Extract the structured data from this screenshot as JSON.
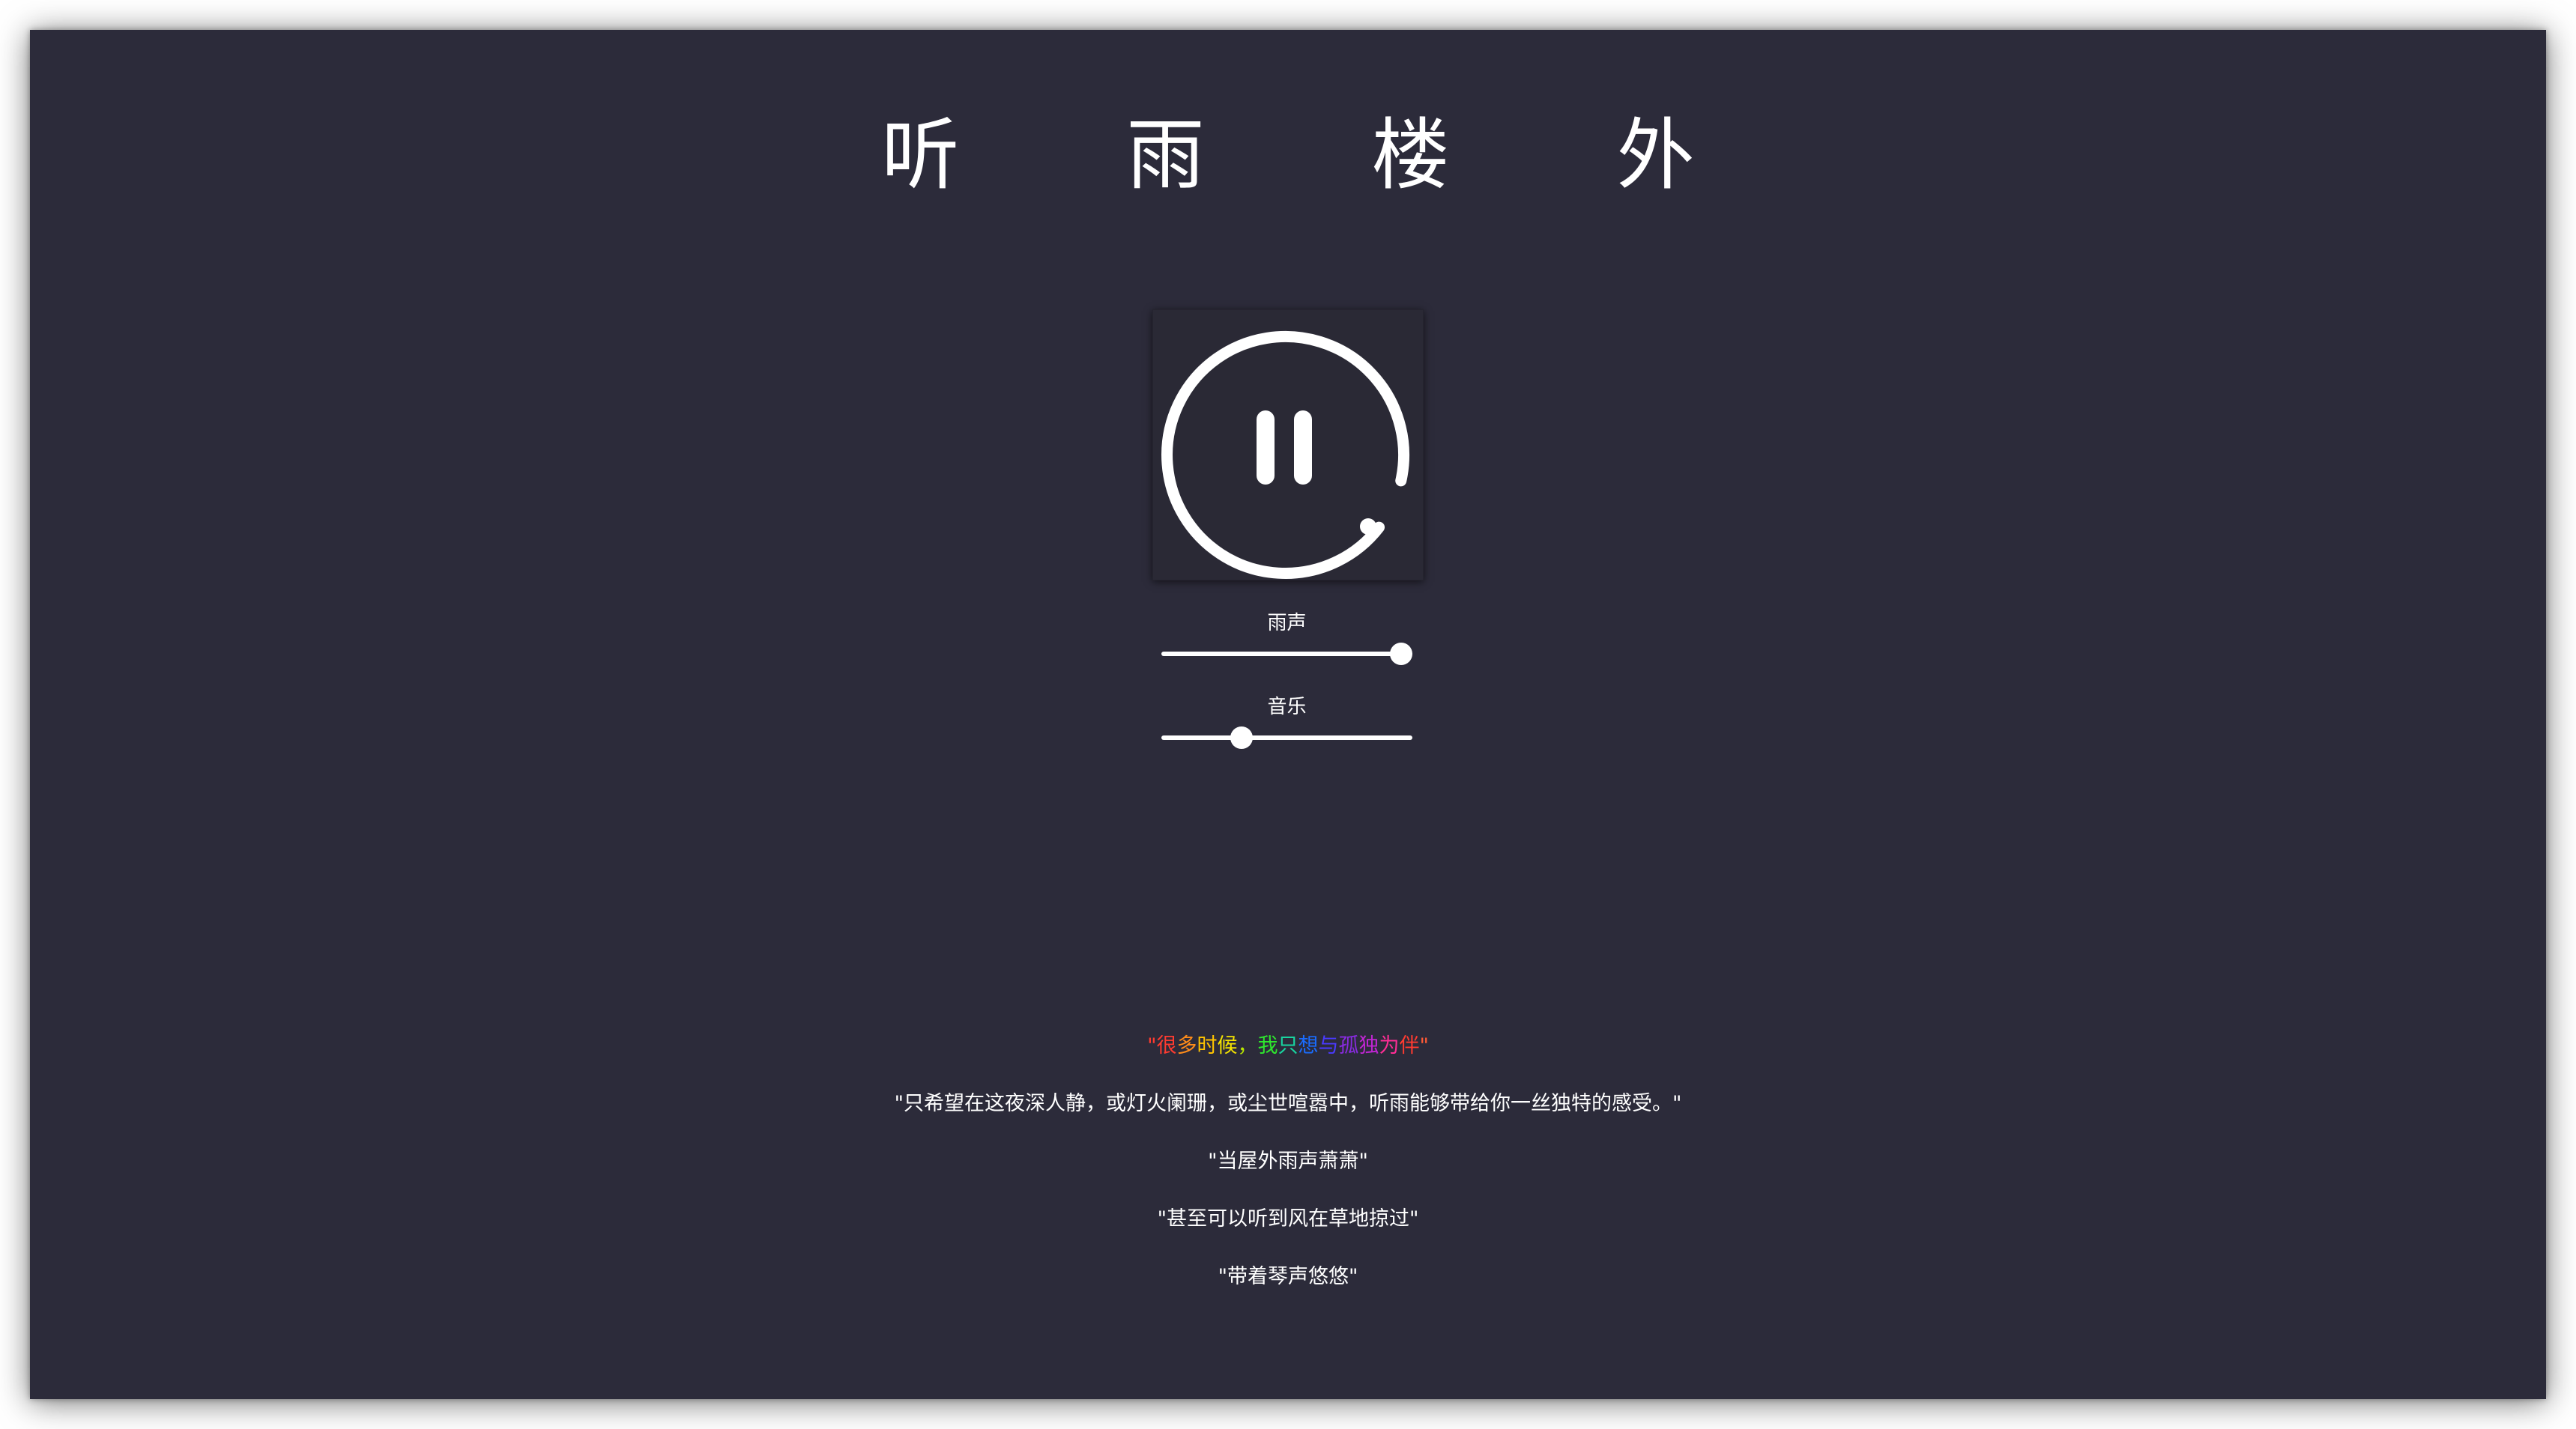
{
  "page": {
    "title": "听 雨 楼 外",
    "background": "#2c2b3a",
    "accent": "#ffffff"
  },
  "player": {
    "state": "playing",
    "icon": "pause-icon"
  },
  "sliders": [
    {
      "label": "雨声",
      "value_fraction": 0.955
    },
    {
      "label": "音乐",
      "value_fraction": 0.32
    }
  ],
  "quotes": {
    "first_chars": [
      {
        "ch": "\"",
        "color": "#ff3b30"
      },
      {
        "ch": "很",
        "color": "#ff3b30"
      },
      {
        "ch": "多",
        "color": "#ff8c1a"
      },
      {
        "ch": "时",
        "color": "#ffc400"
      },
      {
        "ch": "候",
        "color": "#f5e400"
      },
      {
        "ch": "，",
        "color": "#b8e600"
      },
      {
        "ch": "我",
        "color": "#2ee62e"
      },
      {
        "ch": "只",
        "color": "#19d4a0"
      },
      {
        "ch": "想",
        "color": "#1a6cff"
      },
      {
        "ch": "与",
        "color": "#4a3aff"
      },
      {
        "ch": "孤",
        "color": "#8a2be2"
      },
      {
        "ch": "独",
        "color": "#c026d3"
      },
      {
        "ch": "为",
        "color": "#ff2d95"
      },
      {
        "ch": "伴",
        "color": "#ff3b30"
      },
      {
        "ch": "\"",
        "color": "#ff5a36"
      }
    ],
    "lines": [
      "\"只希望在这夜深人静，或灯火阑珊，或尘世喧嚣中，听雨能够带给你一丝独特的感受。\"",
      "\"当屋外雨声萧萧\"",
      "\"甚至可以听到风在草地掠过\"",
      "\"带着琴声悠悠\""
    ]
  }
}
